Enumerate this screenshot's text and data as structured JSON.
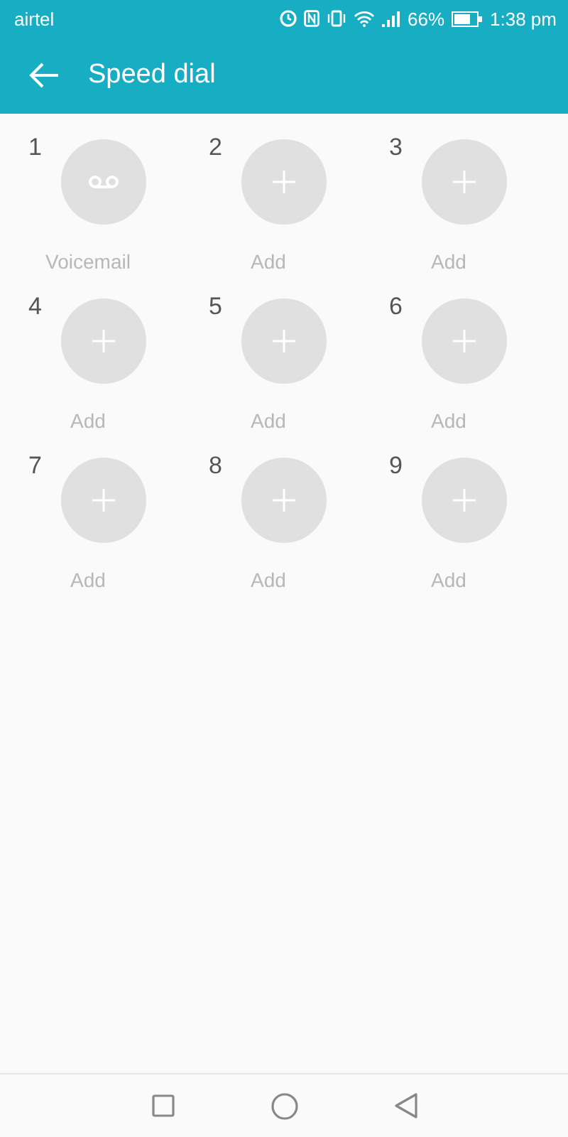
{
  "status_bar": {
    "carrier": "airtel",
    "battery": "66%",
    "time": "1:38 pm"
  },
  "app_bar": {
    "title": "Speed dial"
  },
  "slots": [
    {
      "number": "1",
      "kind": "voicemail",
      "label": "Voicemail"
    },
    {
      "number": "2",
      "kind": "add",
      "label": "Add"
    },
    {
      "number": "3",
      "kind": "add",
      "label": "Add"
    },
    {
      "number": "4",
      "kind": "add",
      "label": "Add"
    },
    {
      "number": "5",
      "kind": "add",
      "label": "Add"
    },
    {
      "number": "6",
      "kind": "add",
      "label": "Add"
    },
    {
      "number": "7",
      "kind": "add",
      "label": "Add"
    },
    {
      "number": "8",
      "kind": "add",
      "label": "Add"
    },
    {
      "number": "9",
      "kind": "add",
      "label": "Add"
    }
  ]
}
